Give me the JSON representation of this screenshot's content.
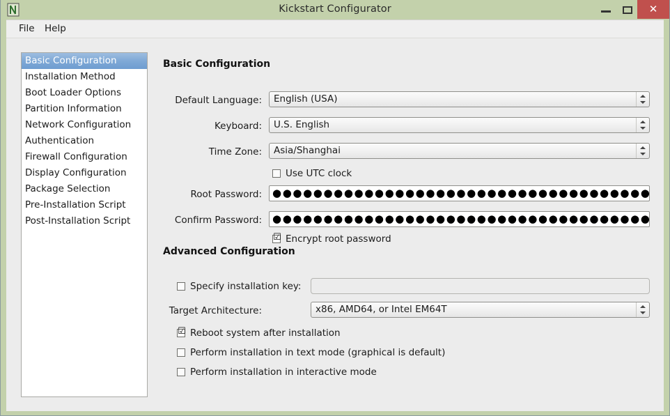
{
  "window": {
    "title": "Kickstart Configurator",
    "icon": "app-icon",
    "minimize_label": "",
    "maximize_label": "",
    "close_label": "✕"
  },
  "menubar": {
    "items": [
      {
        "label": "File"
      },
      {
        "label": "Help"
      }
    ]
  },
  "sidebar": {
    "items": [
      {
        "label": "Basic Configuration",
        "selected": true
      },
      {
        "label": "Installation Method",
        "selected": false
      },
      {
        "label": "Boot Loader Options",
        "selected": false
      },
      {
        "label": "Partition Information",
        "selected": false
      },
      {
        "label": "Network Configuration",
        "selected": false
      },
      {
        "label": "Authentication",
        "selected": false
      },
      {
        "label": "Firewall Configuration",
        "selected": false
      },
      {
        "label": "Display Configuration",
        "selected": false
      },
      {
        "label": "Package Selection",
        "selected": false
      },
      {
        "label": "Pre-Installation Script",
        "selected": false
      },
      {
        "label": "Post-Installation Script",
        "selected": false
      }
    ]
  },
  "basic": {
    "heading": "Basic Configuration",
    "default_language": {
      "label": "Default Language:",
      "value": "English (USA)"
    },
    "keyboard": {
      "label": "Keyboard:",
      "value": "U.S. English"
    },
    "timezone": {
      "label": "Time Zone:",
      "value": "Asia/Shanghai"
    },
    "use_utc": {
      "label": "Use UTC clock",
      "checked": false,
      "mark": ""
    },
    "root_password": {
      "label": "Root Password:",
      "value": "●●●●●●●●●●●●●●●●●●●●●●●●●●●●●●●●●●●●●●●●●●●●"
    },
    "confirm_password": {
      "label": "Confirm Password:",
      "value": "●●●●●●●●●●●●●●●●●●●●●●●●●●●●●●●●●●●●●●●●●●●●"
    },
    "encrypt_root": {
      "label": "Encrypt root password",
      "checked": true,
      "mark": "☑"
    }
  },
  "advanced": {
    "heading": "Advanced Configuration",
    "installation_key": {
      "label": "Specify installation key:",
      "checked": false,
      "mark": "",
      "value": "",
      "placeholder": ""
    },
    "target_architecture": {
      "label": "Target Architecture:",
      "value": "x86, AMD64, or Intel EM64T"
    },
    "reboot_after": {
      "label": "Reboot system after installation",
      "checked": true,
      "mark": "☑"
    },
    "text_mode": {
      "label": "Perform installation in text mode (graphical is default)",
      "checked": false,
      "mark": ""
    },
    "interactive_mode": {
      "label": "Perform installation in interactive mode",
      "checked": false,
      "mark": ""
    }
  },
  "colors": {
    "titlebar": "#c3d1ab",
    "close_button": "#c0504d",
    "selection": "#7fa9d6",
    "panel": "#ececec"
  }
}
